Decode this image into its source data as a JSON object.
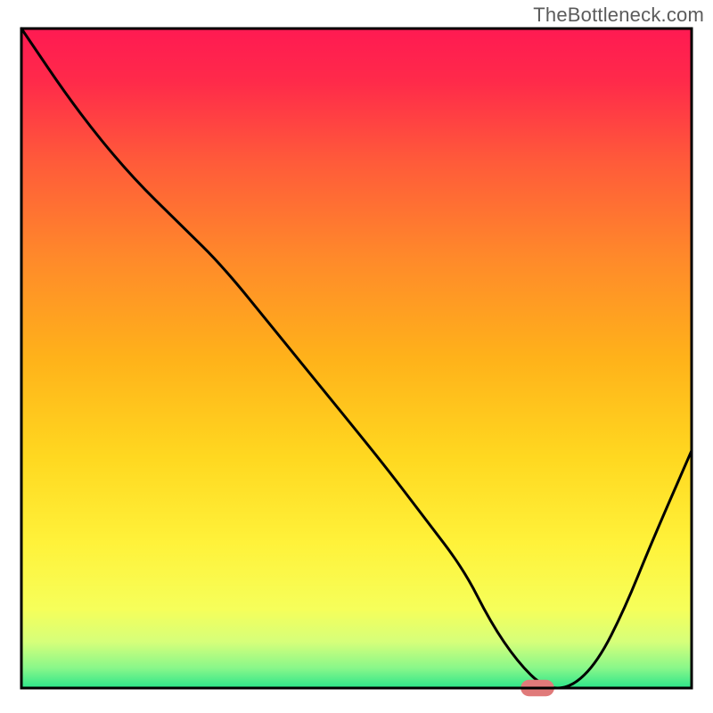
{
  "watermark": "TheBottleneck.com",
  "chart_data": {
    "type": "line",
    "title": "",
    "xlabel": "",
    "ylabel": "",
    "xlim": [
      0,
      100
    ],
    "ylim": [
      0,
      100
    ],
    "grid": false,
    "legend": false,
    "series": [
      {
        "name": "bottleneck-curve",
        "x": [
          0,
          8,
          16,
          24,
          30,
          38,
          46,
          54,
          60,
          66,
          70,
          74,
          78,
          82,
          86,
          90,
          94,
          100
        ],
        "y": [
          100,
          88,
          78,
          70,
          64,
          54,
          44,
          34,
          26,
          18,
          10,
          4,
          0,
          0,
          4,
          12,
          22,
          36
        ]
      }
    ],
    "background_gradient": {
      "stops": [
        {
          "offset": 0.0,
          "color": "#ff1a52"
        },
        {
          "offset": 0.08,
          "color": "#ff2a4a"
        },
        {
          "offset": 0.2,
          "color": "#ff5a3a"
        },
        {
          "offset": 0.35,
          "color": "#ff8a2a"
        },
        {
          "offset": 0.5,
          "color": "#ffb21a"
        },
        {
          "offset": 0.65,
          "color": "#ffd820"
        },
        {
          "offset": 0.78,
          "color": "#fff23a"
        },
        {
          "offset": 0.88,
          "color": "#f6ff5a"
        },
        {
          "offset": 0.93,
          "color": "#d6ff7a"
        },
        {
          "offset": 0.97,
          "color": "#88f78a"
        },
        {
          "offset": 1.0,
          "color": "#2ce58a"
        }
      ]
    },
    "marker": {
      "x": 77,
      "y": 0,
      "color": "#e07a7a",
      "width": 5,
      "height": 2.5
    },
    "frame": {
      "x": 3.0,
      "y": 4.0,
      "width": 94.0,
      "height": 92.5,
      "stroke": "#000000",
      "stroke_width": 3
    }
  }
}
